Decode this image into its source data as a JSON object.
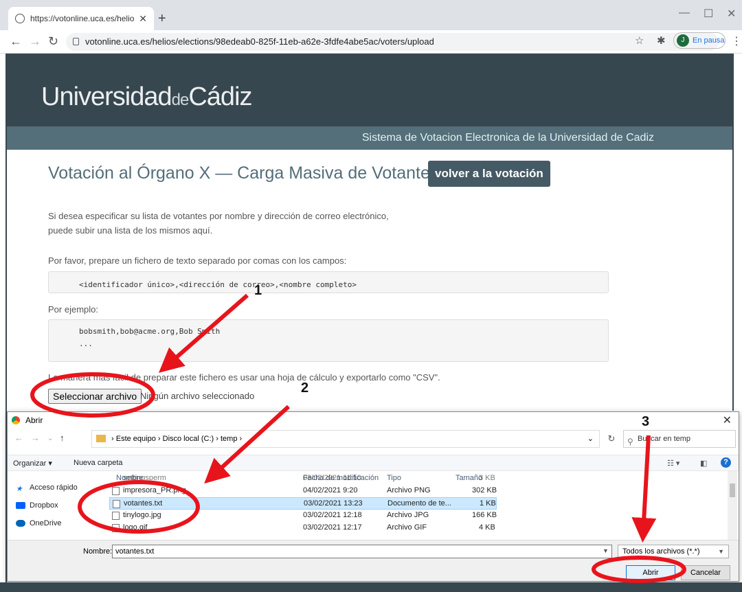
{
  "browser": {
    "tab_title": "https://votonline.uca.es/helios/el",
    "url": "votonline.uca.es/helios/elections/98edeab0-825f-11eb-a62e-3fdfe4abe5ac/voters/upload",
    "profile_initial": "J",
    "profile_label": "En pausa"
  },
  "site": {
    "logo_main": "Universidad",
    "logo_de": "de",
    "logo_end": "Cádiz",
    "subtitle": "Sistema de Votacion Electronica de la Universidad de Cadiz"
  },
  "page": {
    "title": "Votación al Órgano X — Carga Masiva de Votantes",
    "back_button": "volver a la votación",
    "intro_line1": "Si desea especificar su lista de votantes por nombre y dirección de correo electrónico,",
    "intro_line2": "puede subir una lista de los mismos aquí.",
    "prepare": "Por favor, prepare un fichero de texto separado por comas con los campos:",
    "fields_code": "<identificador único>,<dirección de correo>,<nombre completo>",
    "example_label": "Por ejemplo:",
    "example_code": "bobsmith,bob@acme.org,Bob Smith\n...",
    "easiest": "La manera más fácil de preparar este fichero es usar una hoja de cálculo y exportarlo como \"CSV\".",
    "file_button": "Seleccionar archivo",
    "file_status": "Ningún archivo seleccionado"
  },
  "dialog": {
    "title": "Abrir",
    "path": [
      "Este equipo",
      "Disco local (C:)",
      "temp"
    ],
    "search_placeholder": "Buscar en temp",
    "organize": "Organizar ▾",
    "new_folder": "Nueva carpeta",
    "nav_items": [
      "Acceso rápido",
      "Dropbox",
      "OneDrive"
    ],
    "columns": [
      "Nombre",
      "Fecha de modificación",
      "Tipo",
      "Tamaño"
    ],
    "files": [
      {
        "name": "settingsperm",
        "date": "03/02/2021 11:10",
        "type": "",
        "size": "3 KB"
      },
      {
        "name": "impresora_PR.png",
        "date": "04/02/2021 9:20",
        "type": "Archivo PNG",
        "size": "302 KB"
      },
      {
        "name": "votantes.txt",
        "date": "03/02/2021 13:23",
        "type": "Documento de te...",
        "size": "1 KB"
      },
      {
        "name": "tinylogo.jpg",
        "date": "03/02/2021 12:18",
        "type": "Archivo JPG",
        "size": "166 KB"
      },
      {
        "name": "logo.gif",
        "date": "03/02/2021 12:17",
        "type": "Archivo GIF",
        "size": "4 KB"
      }
    ],
    "name_label": "Nombre:",
    "name_value": "votantes.txt",
    "filter": "Todos los archivos (*.*)",
    "open": "Abrir",
    "cancel": "Cancelar"
  },
  "annotations": {
    "step1": "1",
    "step2": "2",
    "step3": "3",
    "color": "#e8141c"
  }
}
